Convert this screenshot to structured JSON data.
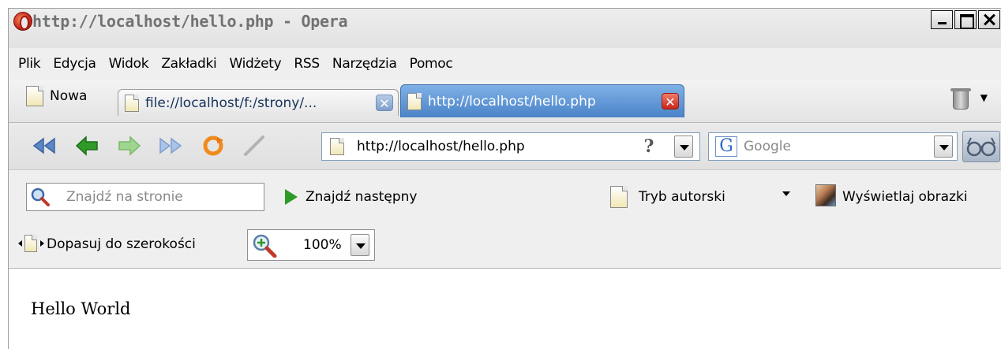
{
  "window": {
    "title": "http://localhost/hello.php - Opera"
  },
  "menu": [
    "Plik",
    "Edycja",
    "Widok",
    "Zakładki",
    "Widżety",
    "RSS",
    "Narzędzia",
    "Pomoc"
  ],
  "tabs": {
    "new_tab_label": "Nowa",
    "items": [
      {
        "label": "file://localhost/f:/strony/...",
        "active": false
      },
      {
        "label": "http://localhost/hello.php",
        "active": true
      }
    ]
  },
  "address_bar": {
    "url": "http://localhost/hello.php",
    "security_label": "?"
  },
  "search": {
    "engine_glyph": "G",
    "placeholder": "Google"
  },
  "find_bar": {
    "placeholder": "Znajdź na stronie",
    "find_next_label": "Znajdź następny",
    "author_mode_label": "Tryb autorski",
    "show_images_label": "Wyświetlaj obrazki"
  },
  "zoom_bar": {
    "fit_width_label": "Dopasuj do szerokości",
    "zoom_value": "100%"
  },
  "content": {
    "text": "Hello World"
  },
  "icons": {
    "title": "opera-icon",
    "back_start": "rewind-icon",
    "back": "back-arrow-icon",
    "forward": "forward-arrow-icon",
    "fast_forward": "fast-forward-icon",
    "reload": "reload-icon",
    "edit": "pen-icon",
    "page": "page-icon",
    "trash": "trash-icon",
    "magnifier": "magnifier-icon",
    "find_next": "play-icon",
    "show_images": "image-icon",
    "zoom": "zoom-icon",
    "glasses": "glasses-icon"
  },
  "colors": {
    "active_tab": "#4a83c8",
    "close_tab": "#c8281b",
    "arrow_green": "#2e9a28",
    "arrow_blue": "#5b87c5"
  }
}
